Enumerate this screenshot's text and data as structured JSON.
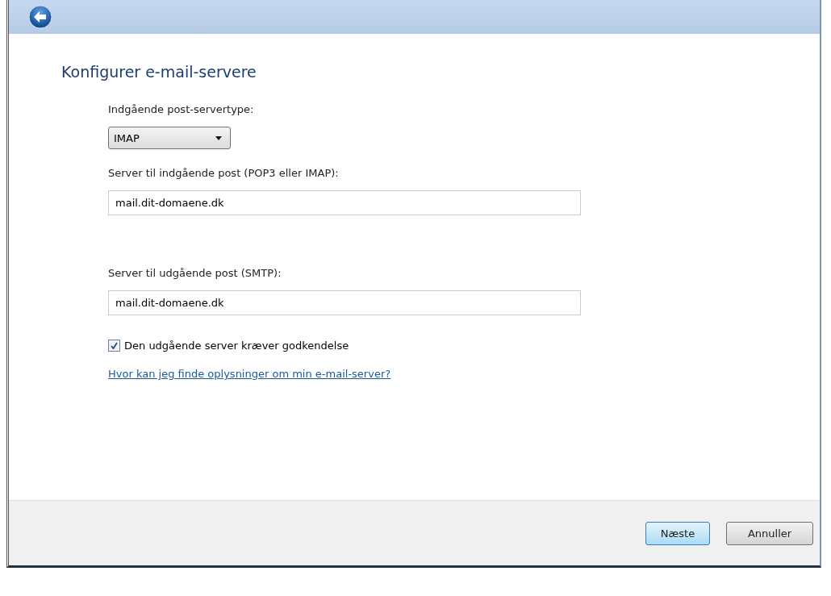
{
  "heading": "Konfigurer e-mail-servere",
  "server_type": {
    "label": "Indgående post-servertype:",
    "value": "IMAP"
  },
  "incoming": {
    "label": "Server til indgående post (POP3 eller IMAP):",
    "value": "mail.dit-domaene.dk"
  },
  "outgoing": {
    "label": "Server til udgående post (SMTP):",
    "value": "mail.dit-domaene.dk"
  },
  "auth": {
    "label": "Den udgående server kræver godkendelse",
    "checked": true
  },
  "help_link": "Hvor kan jeg finde oplysninger om min e-mail-server?",
  "buttons": [
    {
      "label": "Næste",
      "default": true
    },
    {
      "label": "Annuller",
      "default": false
    }
  ]
}
